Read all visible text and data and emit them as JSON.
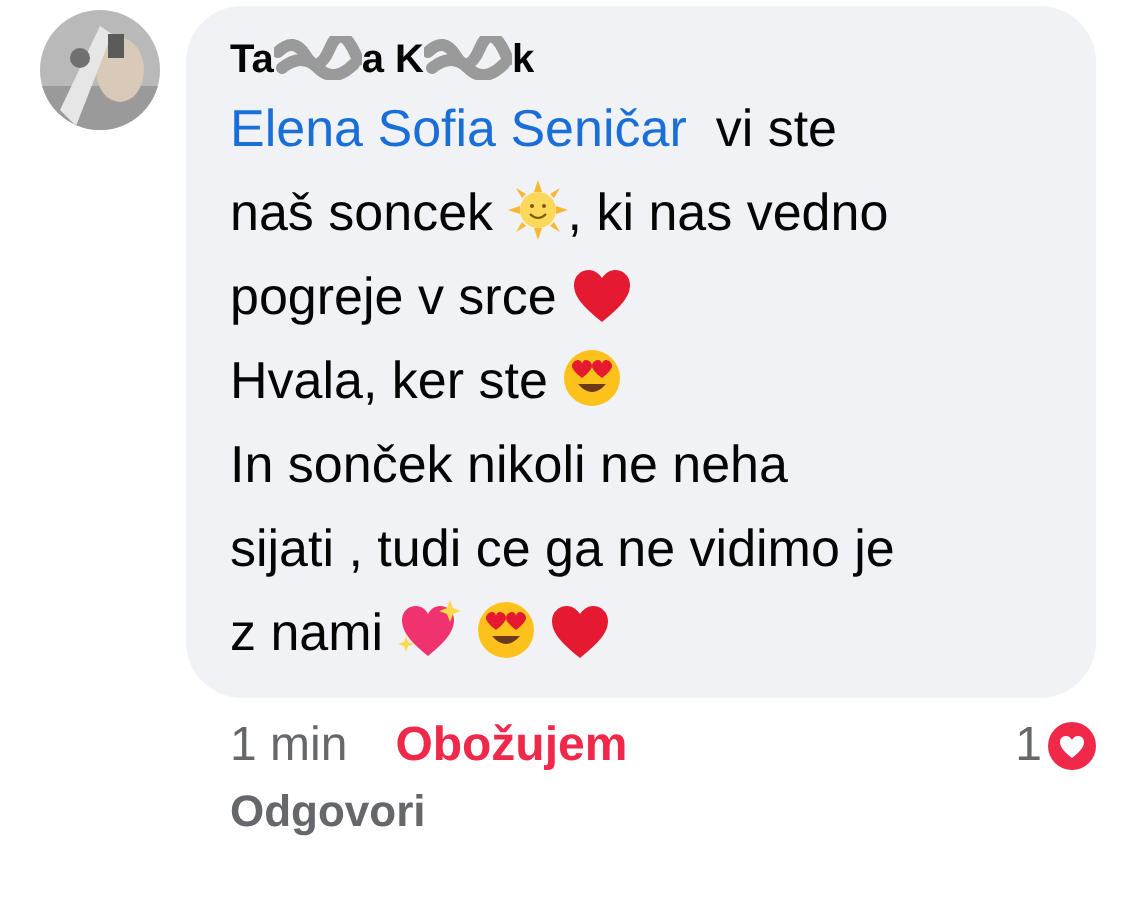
{
  "comment": {
    "author_parts": [
      "Ta",
      "a K",
      "k"
    ],
    "lines": [
      [
        {
          "kind": "mention",
          "text": "Elena Sofia Seničar"
        },
        {
          "kind": "text",
          "text": "  vi ste"
        }
      ],
      [
        {
          "kind": "text",
          "text": "naš soncek "
        },
        {
          "kind": "sun"
        },
        {
          "kind": "text",
          "text": ", ki nas vedno"
        }
      ],
      [
        {
          "kind": "text",
          "text": "pogreje v srce "
        },
        {
          "kind": "heart"
        }
      ],
      [
        {
          "kind": "text",
          "text": "Hvala, ker ste "
        },
        {
          "kind": "heart-eyes"
        }
      ],
      [
        {
          "kind": "text",
          "text": "In sonček nikoli ne neha"
        }
      ],
      [
        {
          "kind": "text",
          "text": "sijati , tudi ce ga ne vidimo je"
        }
      ],
      [
        {
          "kind": "text",
          "text": "z nami "
        },
        {
          "kind": "sparkle-heart"
        },
        {
          "kind": "space"
        },
        {
          "kind": "heart-eyes"
        },
        {
          "kind": "space"
        },
        {
          "kind": "heart"
        }
      ]
    ],
    "time": "1 min",
    "reaction": "Obožujem",
    "reaction_count": "1",
    "reply": "Odgovori"
  }
}
